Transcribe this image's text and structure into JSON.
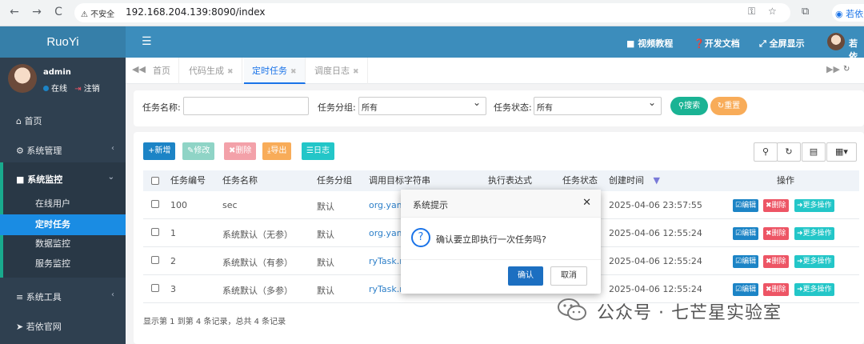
{
  "browser": {
    "back": "←",
    "forward": "→",
    "reload": "C",
    "insecure_label": "不安全",
    "url": "192.168.204.139:8090/index",
    "profile_text": "若依"
  },
  "sidebar": {
    "logo": "RuoYi",
    "user": {
      "name": "admin",
      "online": "在线",
      "logout": "注销"
    },
    "items": [
      {
        "label": "首页",
        "icon": "home-icon"
      },
      {
        "label": "系统管理",
        "icon": "gear-icon"
      },
      {
        "label": "系统监控",
        "icon": "video-icon"
      },
      {
        "label": "系统工具",
        "icon": "bars-icon"
      },
      {
        "label": "若依官网",
        "icon": "send-icon"
      }
    ],
    "subitems": [
      "在线用户",
      "定时任务",
      "数据监控",
      "服务监控"
    ]
  },
  "topbar": {
    "video": "视频教程",
    "docs": "开发文档",
    "fullscreen": "全屏显示",
    "user": "若依"
  },
  "tabs": {
    "items": [
      "首页",
      "代码生成",
      "定时任务",
      "调度日志"
    ],
    "active_index": 2
  },
  "search": {
    "task_name_label": "任务名称:",
    "task_name_value": "",
    "task_group_label": "任务分组:",
    "task_group_value": "所有",
    "task_status_label": "任务状态:",
    "task_status_value": "所有",
    "search_btn": "搜索",
    "reset_btn": "重置"
  },
  "toolbar": {
    "add": "新增",
    "edit": "修改",
    "delete": "删除",
    "export": "导出",
    "log": "日志"
  },
  "table": {
    "columns": [
      "任务编号",
      "任务名称",
      "任务分组",
      "调用目标字符串",
      "执行表达式",
      "任务状态",
      "创建时间",
      "操作"
    ],
    "rows": [
      {
        "id": "100",
        "name": "sec",
        "group": "默认",
        "target": "org.yaml",
        "created": "2025-04-06 23:57:55"
      },
      {
        "id": "1",
        "name": "系统默认（无参）",
        "group": "默认",
        "target": "org.yaml",
        "created": "2025-04-06 12:55:24"
      },
      {
        "id": "2",
        "name": "系统默认（有参）",
        "group": "默认",
        "target": "ryTask.ry",
        "created": "2025-04-06 12:55:24"
      },
      {
        "id": "3",
        "name": "系统默认（多参）",
        "group": "默认",
        "target": "ryTask.ry",
        "created": "2025-04-06 12:55:24"
      }
    ],
    "ops": {
      "edit": "编辑",
      "delete": "删除",
      "more": "更多操作"
    },
    "footer": "显示第 1 到第 4 条记录，总共 4 条记录"
  },
  "modal": {
    "title": "系统提示",
    "message": "确认要立即执行一次任务吗?",
    "confirm": "确认",
    "cancel": "取消"
  },
  "watermark": {
    "text": "公众号 · 七芒星实验室"
  },
  "colors": {
    "sidebar": "#2f4050",
    "topbar": "#3c8dbc",
    "primary": "#1c84c6",
    "success": "#1ab394",
    "warning": "#f8ac59",
    "danger": "#ed5565",
    "info": "#23c6c8"
  }
}
